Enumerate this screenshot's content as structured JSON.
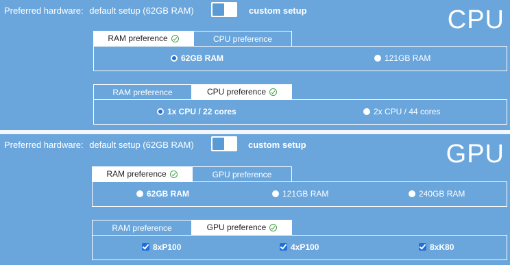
{
  "cpu": {
    "big_label": "CPU",
    "hardware_label": "Preferred hardware:",
    "default_label": "default setup (62GB RAM)",
    "custom_label": "custom setup",
    "ram_tabs": [
      "RAM preference",
      "CPU preference"
    ],
    "ram_options": [
      "62GB RAM",
      "121GB RAM"
    ],
    "cpu_tabs": [
      "RAM preference",
      "CPU preference"
    ],
    "cpu_options": [
      "1x CPU / 22 cores",
      "2x CPU / 44 cores"
    ]
  },
  "gpu": {
    "big_label": "GPU",
    "hardware_label": "Preferred hardware:",
    "default_label": "default setup (62GB RAM)",
    "custom_label": "custom setup",
    "ram_tabs": [
      "RAM preference",
      "GPU preference"
    ],
    "ram_options": [
      "62GB RAM",
      "121GB RAM",
      "240GB RAM"
    ],
    "gpu_tabs": [
      "RAM preference",
      "GPU preference"
    ],
    "gpu_options": [
      "8xP100",
      "4xP100",
      "8xK80"
    ]
  },
  "icons": {
    "tab_check": "check-circle-icon",
    "selected_radio": "radio-selected-icon",
    "checkbox": "checkbox-checked-icon"
  },
  "colors": {
    "background": "#6aa6dc",
    "accent": "#1e6fd9",
    "check": "#43a047"
  }
}
